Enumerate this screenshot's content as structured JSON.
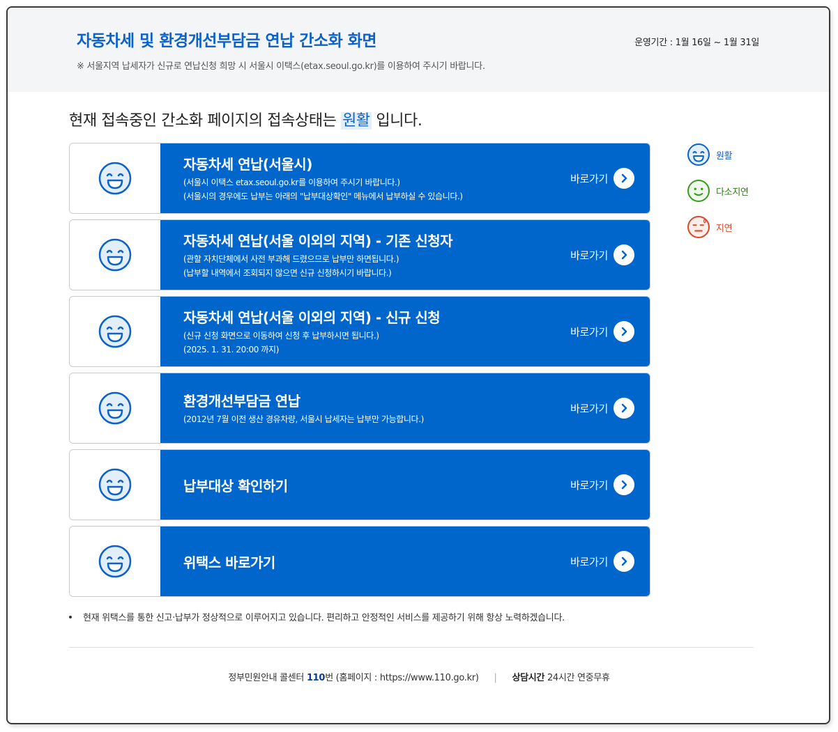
{
  "header": {
    "title": "자동차세 및 환경개선부담금 연납 간소화 화면",
    "notice": "※ 서울지역 납세자가 신규로 연납신청 희망 시 서울시 이택스(etax.seoul.go.kr)를 이용하여 주시기 바랍니다.",
    "period": "운영기간 : 1월 16일 ~ 1월 31일"
  },
  "status": {
    "prefix": "현재 접속중인 간소화 페이지의 접속상태는",
    "word": "원활",
    "suffix": "입니다."
  },
  "cards": [
    {
      "title": "자동차세 연납(서울시)",
      "desc1": "(서울시 이택스 etax.seoul.go.kr를 이용하여 주시기 바랍니다.)",
      "desc2": "(서울시의 경우에도 납부는 아래의 \"납부대상확인\" 메뉴에서 납부하실 수 있습니다.)",
      "go": "바로가기"
    },
    {
      "title": "자동차세 연납(서울 이외의 지역) - 기존 신청자",
      "desc1": "(관할 자치단체에서 사전 부과해 드렸으므로 납부만 하면됩니다.)",
      "desc2": "(납부할 내역에서 조회되지 않으면 신규 신청하시기 바랍니다.)",
      "go": "바로가기"
    },
    {
      "title": "자동차세 연납(서울 이외의 지역) - 신규 신청",
      "desc1": "(신규 신청 화면으로 이동하여 신청 후 납부하시면 됩니다.)",
      "desc2": "(2025. 1. 31. 20:00 까지)",
      "go": "바로가기"
    },
    {
      "title": "환경개선부담금 연납",
      "desc1": "(2012년 7월 이전 생산 경유차량, 서울시 납세자는 납부만 가능합니다.)",
      "desc2": "",
      "go": "바로가기"
    },
    {
      "title": "납부대상 확인하기",
      "desc1": "",
      "desc2": "",
      "go": "바로가기"
    },
    {
      "title": "위택스 바로가기",
      "desc1": "",
      "desc2": "",
      "go": "바로가기"
    }
  ],
  "legend": [
    {
      "label": "원활",
      "color": "#0b62c9",
      "icon": "smile-icon"
    },
    {
      "label": "다소지연",
      "color": "#3a9a1f",
      "icon": "neutral-face-icon"
    },
    {
      "label": "지연",
      "color": "#d9472b",
      "icon": "sweat-face-icon"
    }
  ],
  "bottom_note": "현재 위택스를 통한 신고·납부가 정상적으로 이루어지고 있습니다. 편리하고 안정적인 서비스를 제공하기 위해 항상 노력하겠습니다.",
  "footer": {
    "center_prefix": "정부민원안내 콜센터",
    "center_number": "110",
    "center_suffix": "번 (홈페이지 : https://www.110.go.kr)",
    "hours_label": "상담시간",
    "hours_value": "24시간 연중무휴"
  },
  "colors": {
    "primary": "#0066cc",
    "title_blue": "#0b62c9",
    "header_bg": "#f4f5f7"
  }
}
